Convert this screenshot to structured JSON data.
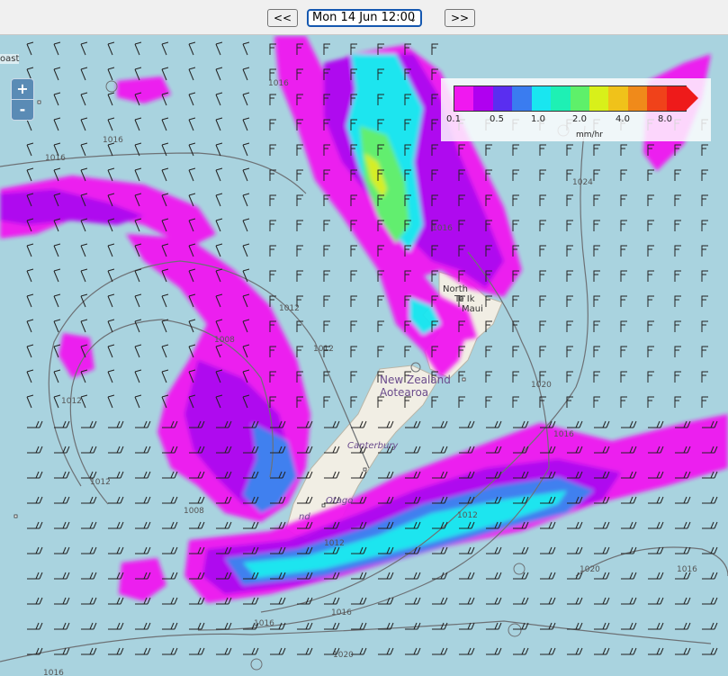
{
  "toolbar": {
    "prev_label": "<<",
    "next_label": ">>",
    "time_selected": "Mon 14 Jun 12:00"
  },
  "zoom": {
    "in_label": "+",
    "out_label": "-"
  },
  "legend": {
    "ticks": [
      "0.1",
      "0.5",
      "1.0",
      "2.0",
      "4.0",
      "8.0"
    ],
    "unit": "mm/hr",
    "colors": [
      "#f018f0",
      "#b000f0",
      "#5a2ef0",
      "#3a7cf0",
      "#19e6f0",
      "#1ef0b4",
      "#5ef06a",
      "#d8f01a",
      "#f0c21a",
      "#f08a1a",
      "#f0421a",
      "#ee1a1a"
    ]
  },
  "labels": {
    "north_island": "North",
    "te_ika": "Te Ik",
    "maui": "Maui",
    "nz": "New Zealand",
    "aotearoa": "Aotearoa",
    "canterbury": "Canterbury",
    "otago": "Otago",
    "coast": "oast",
    "southland_fragment": "nd"
  },
  "isobars": [
    "1016",
    "1016",
    "1016",
    "1012",
    "1008",
    "1012",
    "1012",
    "1012",
    "1024",
    "1016",
    "1012",
    "1016",
    "1020",
    "1016",
    "1020",
    "1016",
    "1016",
    "1016",
    "1020",
    "1012",
    "1008"
  ]
}
